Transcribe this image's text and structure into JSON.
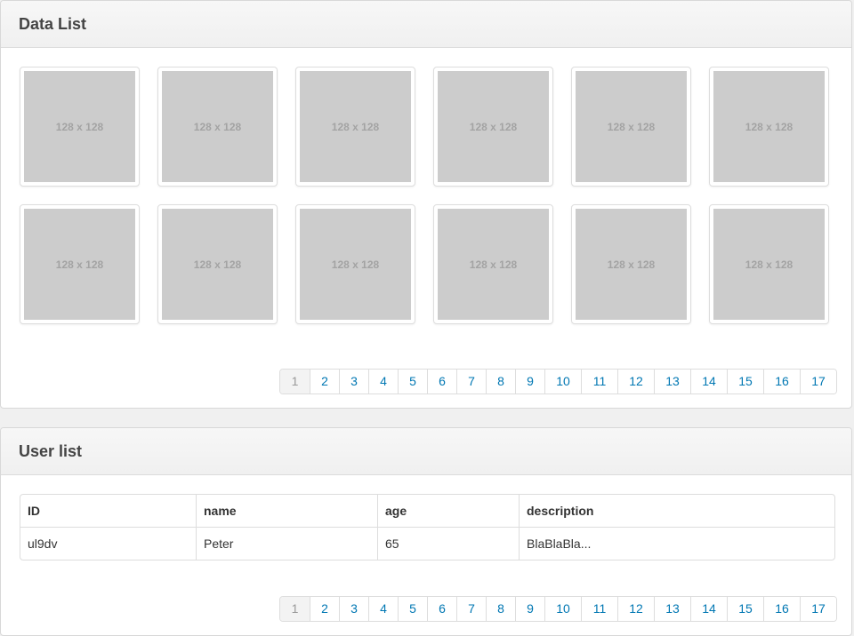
{
  "data_list": {
    "title": "Data List",
    "thumbnails": [
      "128 x 128",
      "128 x 128",
      "128 x 128",
      "128 x 128",
      "128 x 128",
      "128 x 128",
      "128 x 128",
      "128 x 128",
      "128 x 128",
      "128 x 128",
      "128 x 128",
      "128 x 128"
    ],
    "pagination": {
      "pages": [
        "1",
        "2",
        "3",
        "4",
        "5",
        "6",
        "7",
        "8",
        "9",
        "10",
        "11",
        "12",
        "13",
        "14",
        "15",
        "16",
        "17"
      ],
      "active": "1"
    }
  },
  "user_list": {
    "title": "User list",
    "columns": [
      "ID",
      "name",
      "age",
      "description"
    ],
    "rows": [
      [
        "ul9dv",
        "Peter",
        "65",
        "BlaBlaBla..."
      ]
    ],
    "pagination": {
      "pages": [
        "1",
        "2",
        "3",
        "4",
        "5",
        "6",
        "7",
        "8",
        "9",
        "10",
        "11",
        "12",
        "13",
        "14",
        "15",
        "16",
        "17"
      ],
      "active": "1"
    }
  },
  "colors": {
    "link": "#0077b3",
    "placeholder": "#cccccc"
  }
}
